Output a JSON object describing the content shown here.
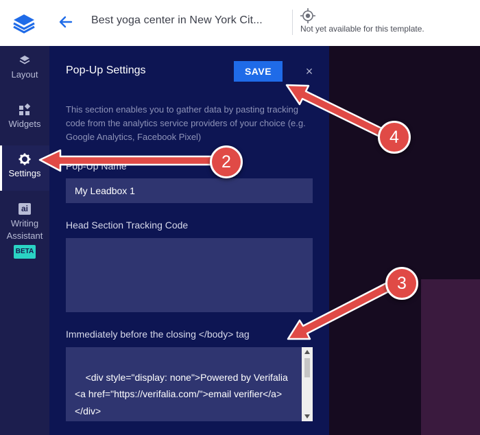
{
  "header": {
    "title": "Best yoga center in New York Cit...",
    "note": "Not yet available for this template."
  },
  "sidebar": {
    "items": [
      {
        "label": "Layout",
        "icon": "layers-icon"
      },
      {
        "label": "Widgets",
        "icon": "widgets-icon"
      },
      {
        "label": "Settings",
        "icon": "gear-icon",
        "active": true
      },
      {
        "label": "Writing\nAssistant",
        "icon": "ai-icon",
        "icon_text": "ai",
        "badge": "BETA"
      }
    ]
  },
  "panel": {
    "title": "Pop-Up Settings",
    "save_label": "SAVE",
    "close_glyph": "×",
    "description": "This section enables you to gather data by pasting tracking code from the analytics service providers of your choice (e.g. Google Analytics, Facebook Pixel)",
    "popup_name_label": "Pop-Up Name",
    "popup_name_value": "My Leadbox 1",
    "head_code_label": "Head Section Tracking Code",
    "head_code_value": "",
    "body_code_label": "Immediately before the closing </body> tag",
    "body_code_value": "<div style=\"display: none\">Powered by Verifalia <a href=\"https://verifalia.com/\">email verifier</a></div>"
  },
  "annotations": [
    "2",
    "3",
    "4"
  ],
  "colors": {
    "accent": "#1f6be8",
    "panel_bg": "#0d1553",
    "nav_bg": "#1c1e4e",
    "badge": "#e04a46",
    "beta": "#2ad3c4"
  }
}
